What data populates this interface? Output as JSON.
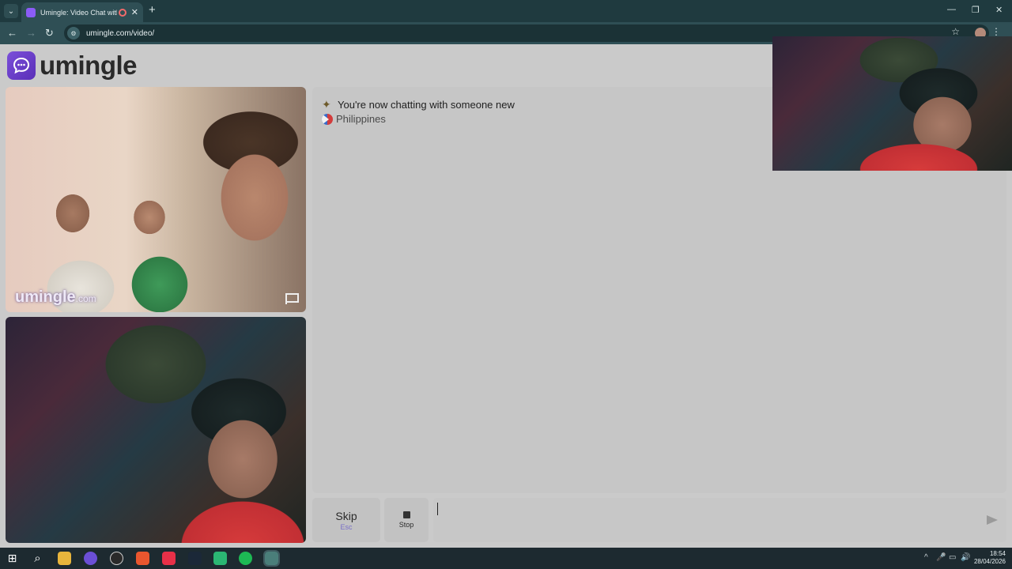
{
  "browser": {
    "tab_title": "Umingle: Video Chat with S",
    "close_glyph": "✕",
    "new_tab_glyph": "+",
    "tab_search_glyph": "⌄",
    "url": "umingle.com/video/",
    "nav": {
      "back": "←",
      "forward": "→",
      "reload": "↻"
    },
    "star_glyph": "☆",
    "menu_glyph": "⋮",
    "window": {
      "minimize": "—",
      "restore": "❐",
      "close": "✕"
    }
  },
  "site": {
    "logo_text": "umingle",
    "watermark_brand": "umingle",
    "watermark_tld": ".com"
  },
  "chat": {
    "icon": "✦",
    "status_message": "You're now chatting with someone new",
    "country": "Philippines"
  },
  "controls": {
    "skip_label": "Skip",
    "skip_shortcut": "Esc",
    "stop_label": "Stop",
    "input_value": ""
  },
  "taskbar": {
    "start_glyph": "⊞",
    "search_glyph": "⌕",
    "tray": {
      "chevron": "^",
      "mic": "🎤",
      "network": "▭",
      "volume": "🔊"
    },
    "time": "18:54",
    "date": "28/04/2026"
  },
  "colors": {
    "tab_bar": "#1f3a3f",
    "toolbar": "#2f4f55",
    "brand_purple": "#6b3fcf",
    "page_bg": "#cacaca"
  }
}
